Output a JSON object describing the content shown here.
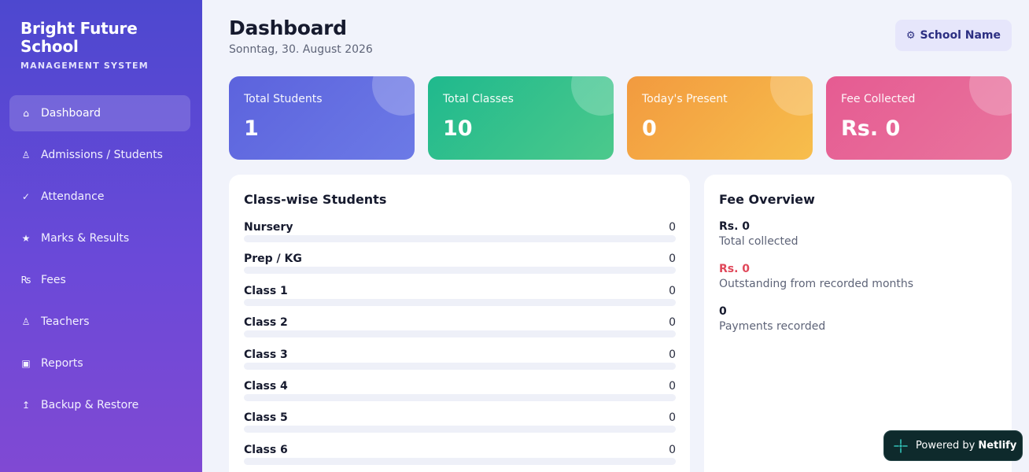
{
  "brand": {
    "title": "Bright Future School",
    "subtitle": "MANAGEMENT SYSTEM"
  },
  "nav": [
    {
      "label": "Dashboard",
      "icon": "home-icon",
      "glyph": "⌂",
      "active": true
    },
    {
      "label": "Admissions / Students",
      "icon": "student-icon",
      "glyph": "♙",
      "active": false
    },
    {
      "label": "Attendance",
      "icon": "check-icon",
      "glyph": "✓",
      "active": false
    },
    {
      "label": "Marks & Results",
      "icon": "star-icon",
      "glyph": "★",
      "active": false
    },
    {
      "label": "Fees",
      "icon": "rupee-icon",
      "glyph": "₨",
      "active": false
    },
    {
      "label": "Teachers",
      "icon": "teacher-icon",
      "glyph": "♙",
      "active": false
    },
    {
      "label": "Reports",
      "icon": "report-icon",
      "glyph": "▣",
      "active": false
    },
    {
      "label": "Backup & Restore",
      "icon": "backup-icon",
      "glyph": "↥",
      "active": false
    }
  ],
  "header": {
    "title": "Dashboard",
    "date": "Sonntag, 30. August 2026",
    "school_button": {
      "icon": "gear-icon",
      "glyph": "⚙",
      "label": "School Name"
    }
  },
  "stats": [
    {
      "label": "Total Students",
      "value": "1"
    },
    {
      "label": "Total Classes",
      "value": "10"
    },
    {
      "label": "Today's Present",
      "value": "0"
    },
    {
      "label": "Fee Collected",
      "value": "Rs. 0"
    }
  ],
  "class_wise": {
    "title": "Class-wise Students",
    "rows": [
      {
        "name": "Nursery",
        "count": "0",
        "fraction": 0
      },
      {
        "name": "Prep / KG",
        "count": "0",
        "fraction": 0
      },
      {
        "name": "Class 1",
        "count": "0",
        "fraction": 0
      },
      {
        "name": "Class 2",
        "count": "0",
        "fraction": 0
      },
      {
        "name": "Class 3",
        "count": "0",
        "fraction": 0
      },
      {
        "name": "Class 4",
        "count": "0",
        "fraction": 0
      },
      {
        "name": "Class 5",
        "count": "0",
        "fraction": 0
      },
      {
        "name": "Class 6",
        "count": "0",
        "fraction": 0
      }
    ]
  },
  "fee_overview": {
    "title": "Fee Overview",
    "items": [
      {
        "value": "Rs. 0",
        "label": "Total collected",
        "color": "#161a2e"
      },
      {
        "value": "Rs. 0",
        "label": "Outstanding from recorded months",
        "color": "#e0485a"
      },
      {
        "value": "0",
        "label": "Payments recorded",
        "color": "#161a2e"
      }
    ]
  },
  "netlify_badge": {
    "prefix": "Powered by",
    "brand": "Netlify",
    "icon": "netlify-icon"
  },
  "colors": {
    "sidebar_top": "#4d48cf",
    "sidebar_bottom": "#8049d3",
    "accent": "#6366e0",
    "danger": "#e0485a"
  }
}
